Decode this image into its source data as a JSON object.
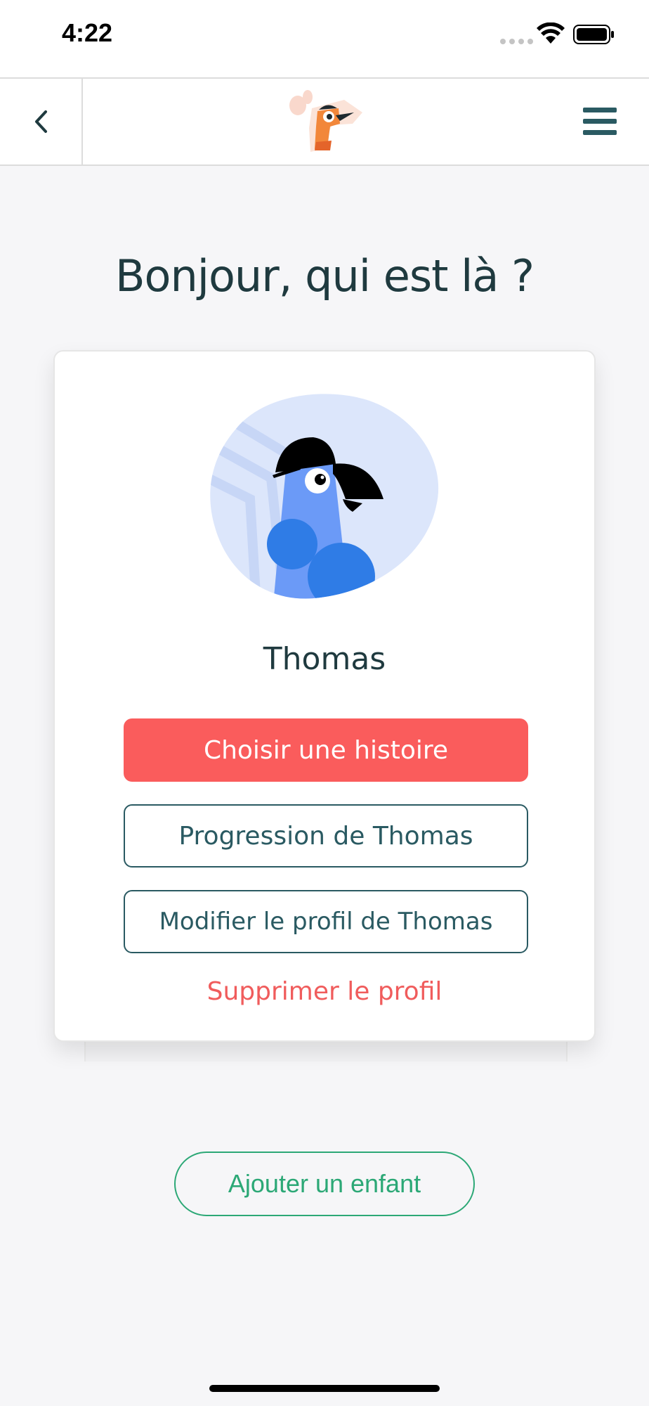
{
  "status_bar": {
    "time": "4:22"
  },
  "nav": {
    "back_icon": "chevron-left-icon",
    "logo_icon": "bird-logo-icon",
    "menu_icon": "hamburger-menu-icon"
  },
  "page": {
    "title": "Bonjour, qui est là ?"
  },
  "profile": {
    "avatar_icon": "blue-bird-with-cap-avatar",
    "name": "Thomas",
    "choose_story_label": "Choisir une histoire",
    "progress_label": "Progression de Thomas",
    "edit_profile_label": "Modifier le profil de Thomas",
    "delete_profile_label": "Supprimer le profil"
  },
  "actions": {
    "add_child_label": "Ajouter un enfant"
  },
  "colors": {
    "primary": "#fa5c5c",
    "dark_teal": "#2a5a62",
    "green": "#2ca876",
    "background": "#f6f6f8"
  }
}
